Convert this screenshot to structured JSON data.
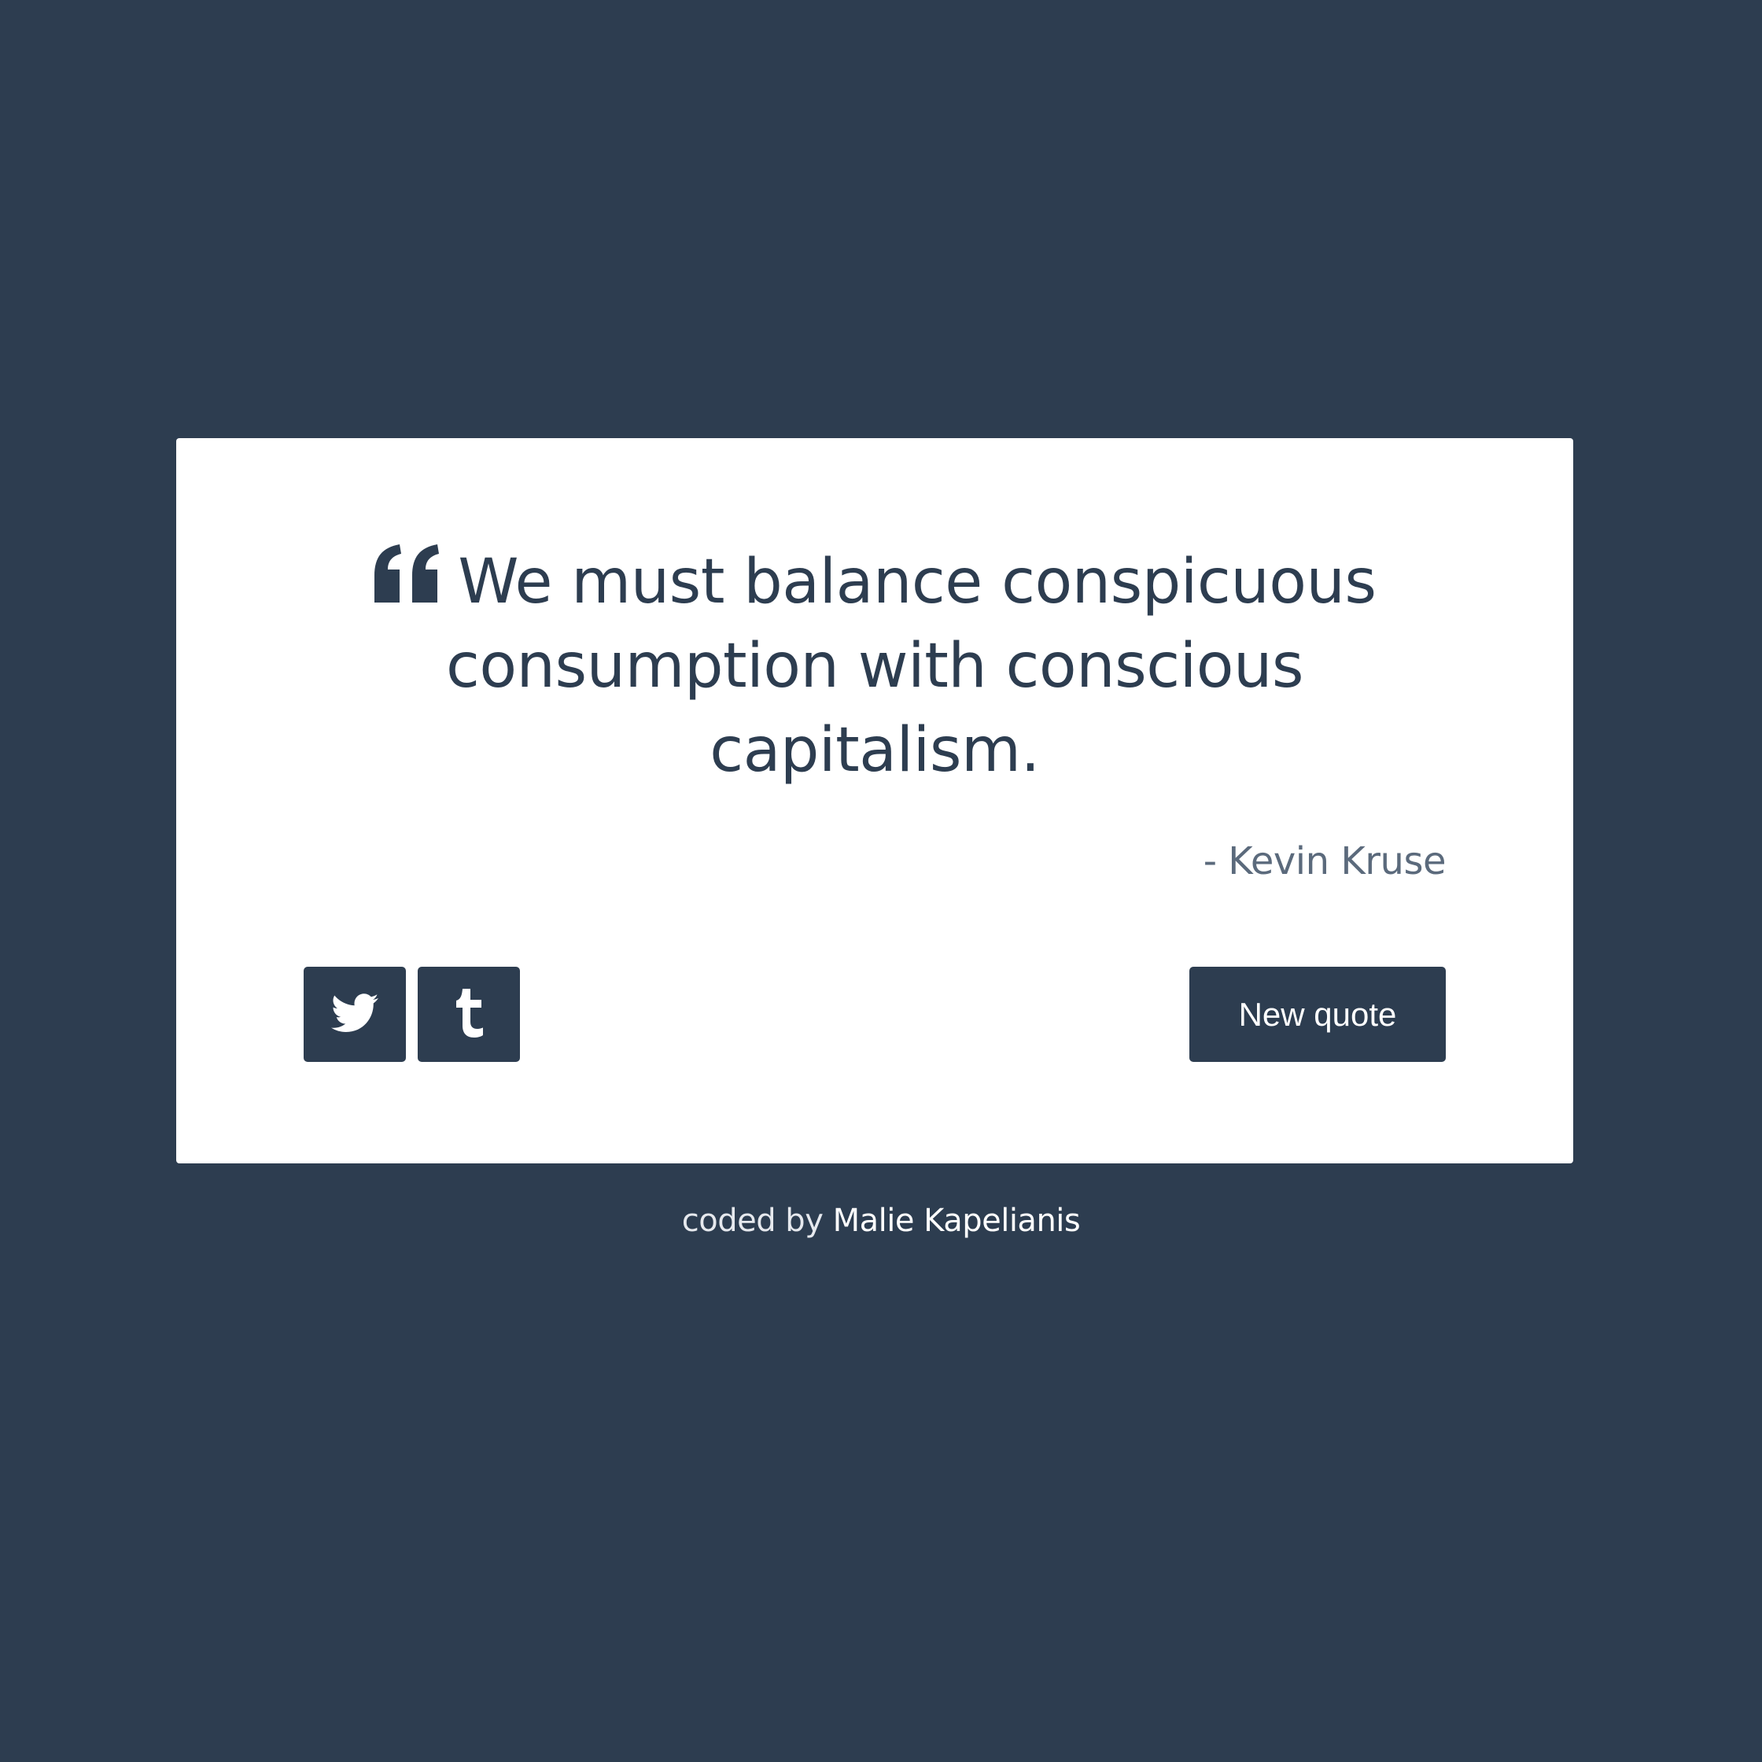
{
  "colors": {
    "background": "#2d3d50",
    "card": "#ffffff",
    "accent": "#2d3d50",
    "author_text": "#5b6a7c"
  },
  "quote": {
    "icon": "quote-left-icon",
    "text": "We must balance conspicuous consumption with conscious capitalism.",
    "author": "- Kevin Kruse"
  },
  "actions": {
    "twitter_icon": "twitter-icon",
    "tumblr_icon": "tumblr-icon",
    "new_quote_label": "New quote"
  },
  "footer": {
    "prefix": "coded by",
    "author": "Malie Kapelianis"
  }
}
